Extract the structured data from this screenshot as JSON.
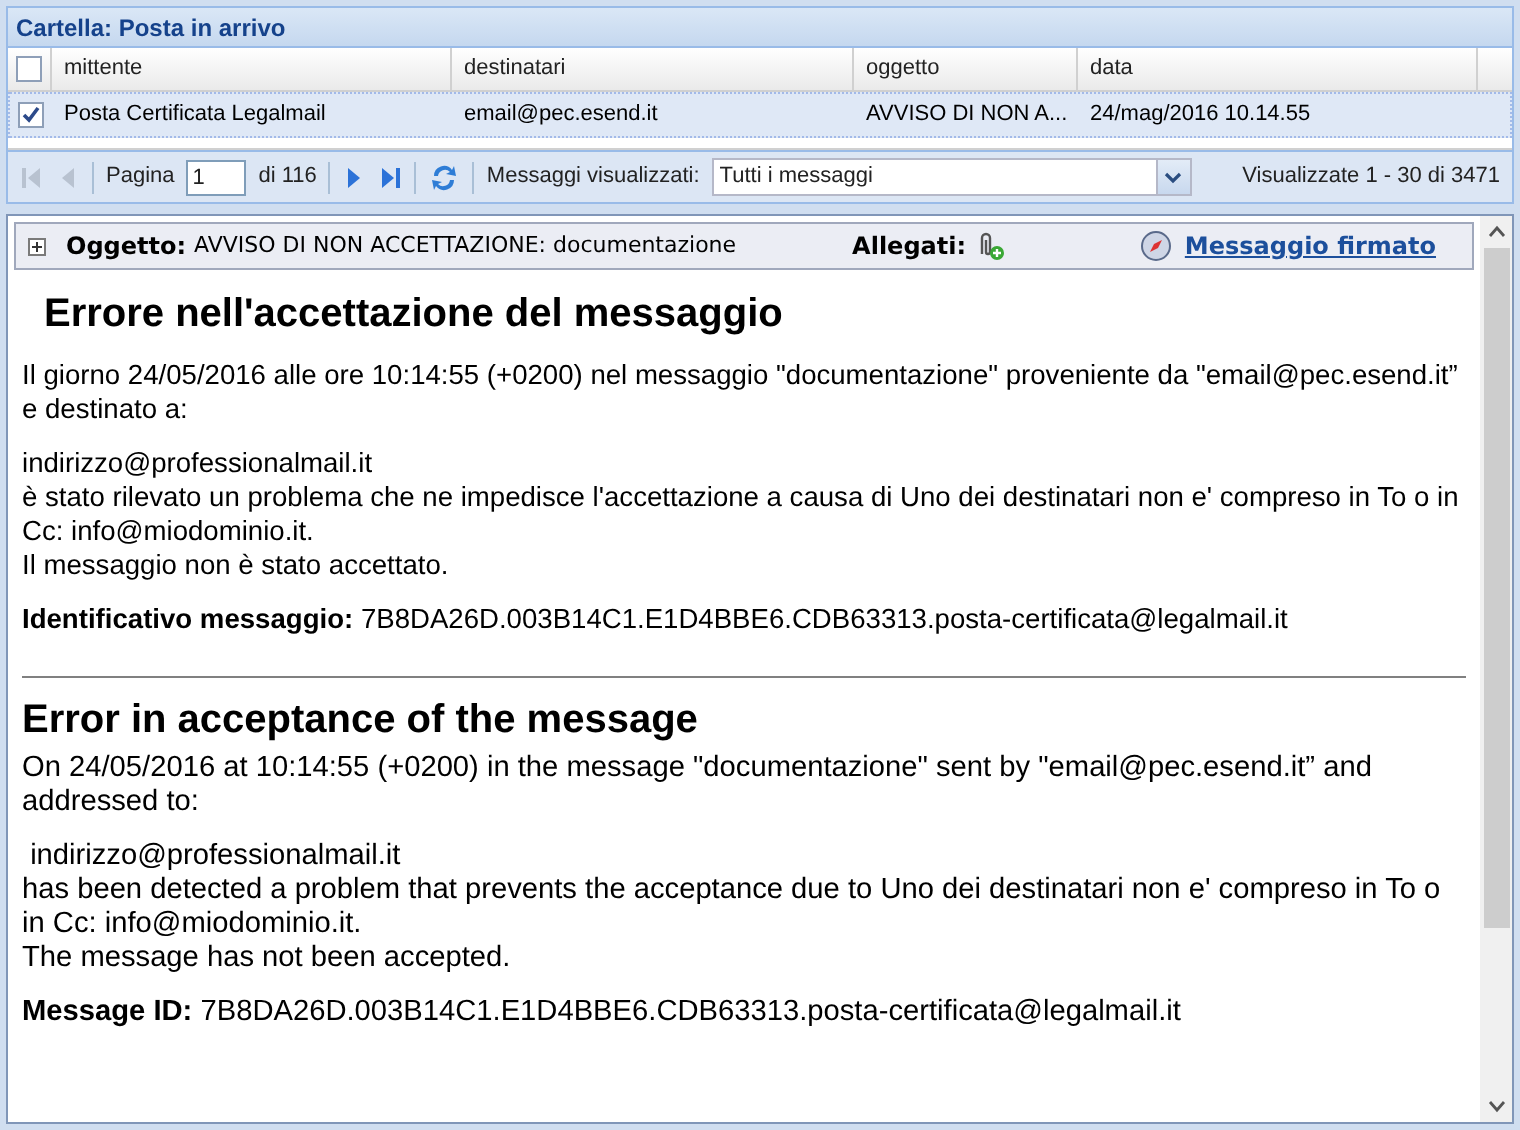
{
  "folder": {
    "title": "Cartella: Posta in arrivo"
  },
  "table": {
    "all_checked": false,
    "columns": [
      "mittente",
      "destinatari",
      "oggetto",
      "data"
    ],
    "rows": [
      {
        "checked": true,
        "selected": true,
        "cells": [
          "Posta Certificata Legalmail",
          "email@pec.esend.it",
          "AVVISO DI NON A...",
          "24/mag/2016 10.14.55"
        ]
      }
    ]
  },
  "pager": {
    "page_label": "Pagina",
    "page": "1",
    "of": "di 116",
    "filter_label": "Messaggi visualizzati:",
    "filter": "Tutti i messaggi",
    "summary": "Visualizzate 1 - 30 di 3471"
  },
  "message": {
    "expanded": false,
    "subject_label": "Oggetto:",
    "subject": "AVVISO DI NON ACCETTAZIONE: documentazione",
    "attachments_label": "Allegati:",
    "signed_link": "Messaggio firmato",
    "sections": [
      {
        "heading": "Errore nell'accettazione del messaggio",
        "indent": true,
        "paragraphs": [
          [
            "Il giorno 24/05/2016 alle ore 10:14:55 (+0200) nel messaggio \"documentazione\" proveniente da \"email@pec.esend.it” e destinato a:"
          ],
          [
            "indirizzo@professionalmail.it",
            "è stato rilevato un problema che ne impedisce l'accettazione a causa di Uno dei destinatari non e' compreso in To o in Cc: info@miodominio.it.",
            "Il messaggio non è stato accettato."
          ],
          [
            "**Identificativo messaggio:** 7B8DA26D.003B14C1.E1D4BBE6.CDB63313.posta-certificata@legalmail.it"
          ]
        ]
      },
      {
        "heading": "Error in acceptance of the message",
        "indent": false,
        "paragraphs": [
          [
            "On 24/05/2016 at 10:14:55 (+0200) in the message \"documentazione\" sent by \"email@pec.esend.it” and addressed to:"
          ],
          [
            " indirizzo@professionalmail.it",
            "has been detected a problem that prevents the acceptance due to Uno dei destinatari non e' compreso in To o in Cc: info@miodominio.it.",
            "The message has not been accepted."
          ],
          [
            "**Message ID:** 7B8DA26D.003B14C1.E1D4BBE6.CDB63313.posta-certificata@legalmail.it"
          ]
        ]
      }
    ]
  }
}
